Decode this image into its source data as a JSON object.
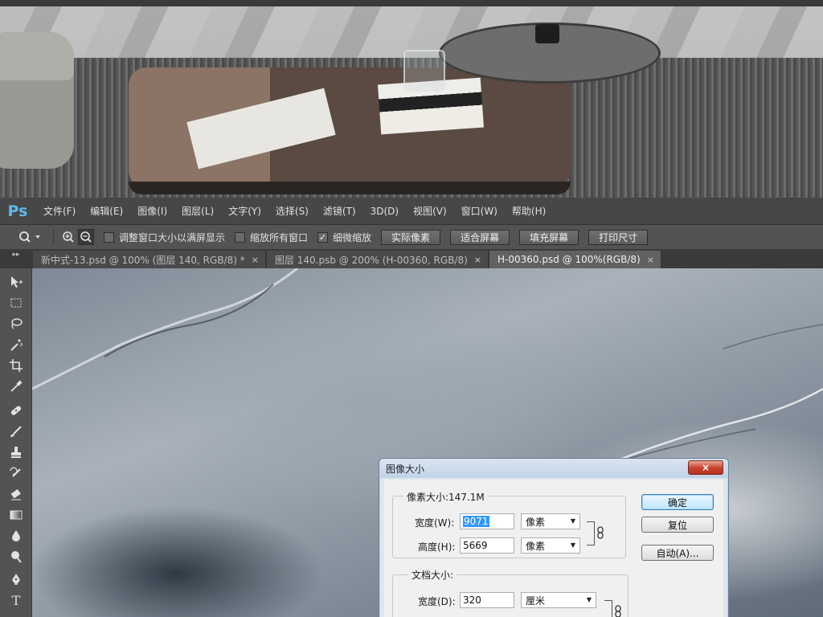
{
  "app": {
    "logo": "Ps",
    "menu": [
      "文件(F)",
      "编辑(E)",
      "图像(I)",
      "图层(L)",
      "文字(Y)",
      "选择(S)",
      "滤镜(T)",
      "3D(D)",
      "视图(V)",
      "窗口(W)",
      "帮助(H)"
    ]
  },
  "options": {
    "resize_windows": {
      "label": "调整窗口大小以满屏显示",
      "checked": false
    },
    "zoom_all": {
      "label": "缩放所有窗口",
      "checked": false
    },
    "scrubby_zoom": {
      "label": "细微缩放",
      "checked": true
    },
    "actual_pixels": "实际像素",
    "fit_screen": "适合屏幕",
    "fill_screen": "填充屏幕",
    "print_size": "打印尺寸"
  },
  "tabs": [
    {
      "label": "新中式-13.psd @ 100% (图层 140, RGB/8) *",
      "close": "×",
      "active": false
    },
    {
      "label": "图层 140.psb @ 200% (H-00360, RGB/8)",
      "close": "×",
      "active": false
    },
    {
      "label": "H-00360.psd @ 100%(RGB/8)",
      "close": "×",
      "active": true
    }
  ],
  "tab_gutter": "▸▸",
  "tools": [
    "move-tool",
    "marquee-tool",
    "lasso-tool",
    "magic-wand-tool",
    "crop-tool",
    "eyedropper-tool",
    "healing-brush-tool",
    "brush-tool",
    "clone-stamp-tool",
    "history-brush-tool",
    "eraser-tool",
    "gradient-tool",
    "blur-tool",
    "dodge-tool",
    "pen-tool",
    "type-tool"
  ],
  "type_tool_glyph": "T",
  "dialog": {
    "title": "图像大小",
    "close": "×",
    "pixel_dimensions": {
      "legend": "像素大小:147.1M",
      "width_label": "宽度(W):",
      "width_value": "9071",
      "width_unit": "像素",
      "height_label": "高度(H):",
      "height_value": "5669",
      "height_unit": "像素"
    },
    "document_size": {
      "legend": "文档大小:",
      "width_label": "宽度(D):",
      "width_value": "320",
      "width_unit": "厘米"
    },
    "buttons": {
      "ok": "确定",
      "reset": "复位",
      "auto": "自动(A)..."
    }
  }
}
